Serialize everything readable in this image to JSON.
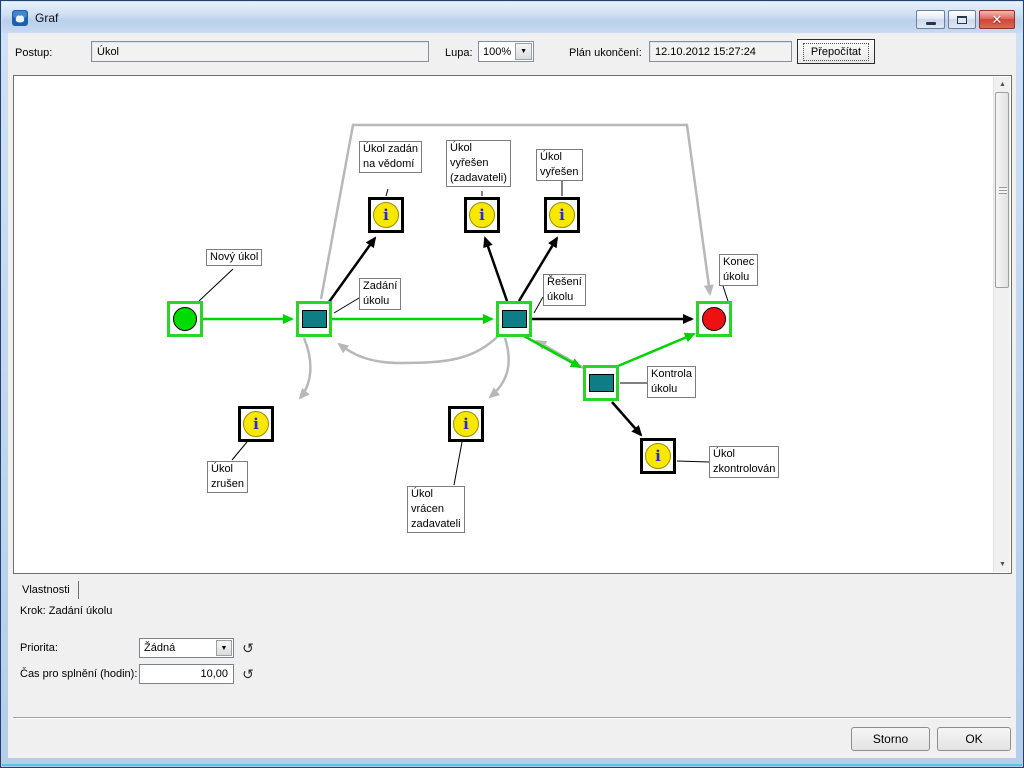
{
  "window": {
    "title": "Graf"
  },
  "toolbar": {
    "postup_label": "Postup:",
    "postup_value": "Úkol",
    "lupa_label": "Lupa:",
    "lupa_value": "100%",
    "plan_label": "Plán ukončení:",
    "plan_value": "12.10.2012 15:27:24",
    "recalc_button": "Přepočítat",
    "dropdown_glyph": "▼"
  },
  "diagram": {
    "info_glyph": "i",
    "labels": {
      "novy_ukol": "Nový úkol",
      "zadani_ukolu": "Zadání\núkolu",
      "reseni_ukolu": "Řešení\núkolu",
      "kontrola_ukolu": "Kontrola\núkolu",
      "konec_ukolu": "Konec\núkolu",
      "ukol_zadan_na_vedomi": "Úkol zadán\nna vědomí",
      "ukol_vyresen_zadavateli": "Úkol\nvyřešen\n(zadavateli)",
      "ukol_vyresen": "Úkol\nvyřešen",
      "ukol_zrusen": "Úkol\nzrušen",
      "ukol_vracen_zadavateli": "Úkol\nvrácen\nzadavateli",
      "ukol_zkontrolovan": "Úkol\nzkontrolován"
    }
  },
  "properties": {
    "tab_label": "Vlastnosti",
    "step_line": "Krok: Zadání úkolu",
    "priority_label": "Priorita:",
    "priority_value": "Žádná",
    "time_label": "Čas pro splnění (hodin):",
    "time_value": "10,00",
    "reset_glyph": "↺",
    "dropdown_glyph": "▼"
  },
  "footer": {
    "storno_button": "Storno",
    "ok_button": "OK"
  },
  "scrollbar": {
    "up_glyph": "▲",
    "down_glyph": "▼"
  },
  "colors": {
    "active_path": "#00d400",
    "inactive_path": "#b8b8b8",
    "normal_path": "#000000",
    "step_fill": "#0e7e86",
    "start_fill": "#00dc00",
    "end_fill": "#ee1111",
    "info_fill": "#f8e800"
  }
}
